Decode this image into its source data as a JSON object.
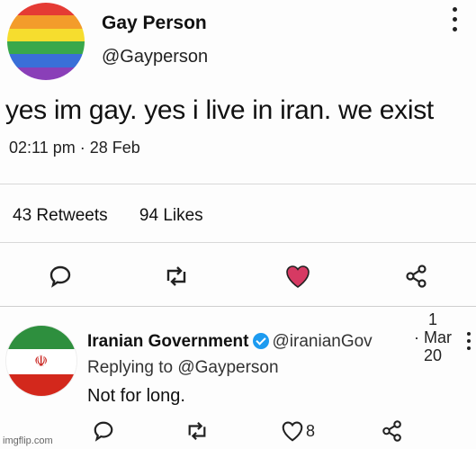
{
  "post": {
    "author_name": "Gay Person",
    "author_handle": "@Gayperson",
    "text": "yes im gay. yes i live in iran. we exist",
    "timestamp": "02:11 pm · 28 Feb",
    "retweets": "43 Retweets",
    "likes": "94 Likes",
    "avatar_colors": [
      "#e53b34",
      "#f39c2b",
      "#f6dd2e",
      "#39a84b",
      "#3a6fd8",
      "#8a3fb8"
    ],
    "heart_color": "#d63a63",
    "icons": [
      "comment-icon",
      "retweet-icon",
      "heart-icon",
      "share-icon"
    ]
  },
  "reply": {
    "author_name": "Iranian Government",
    "author_handle": "@iranianGov",
    "date_line1": "1",
    "date_line2": "· Mar",
    "date_line3": "20",
    "replying_to": "Replying to @Gayperson",
    "text": "Not for long.",
    "like_count": "8",
    "flag_colors": [
      "#2e8f3e",
      "#ffffff",
      "#d3281c"
    ],
    "verified_color": "#1d9bf0",
    "icons": [
      "comment-icon",
      "retweet-icon",
      "heart-icon",
      "share-icon"
    ]
  },
  "watermark": "imgflip.com"
}
